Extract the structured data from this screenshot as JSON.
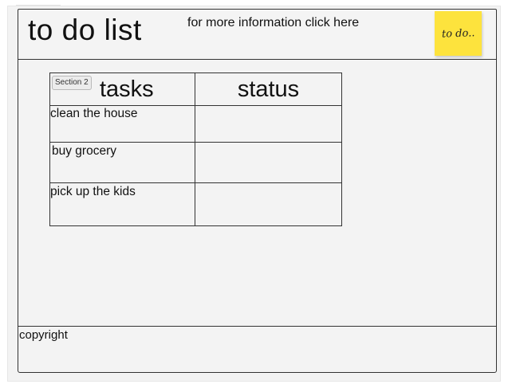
{
  "header": {
    "title": "to do list",
    "info_link": "for more information click here",
    "sticky_note": "to do.."
  },
  "table": {
    "section_badge": "Section 2",
    "columns": [
      "tasks",
      "status"
    ],
    "rows": [
      {
        "task": "clean the house",
        "status": ""
      },
      {
        "task": "buy grocery",
        "status": ""
      },
      {
        "task": "pick up the kids",
        "status": ""
      }
    ]
  },
  "footer": {
    "copyright": "copyright"
  }
}
